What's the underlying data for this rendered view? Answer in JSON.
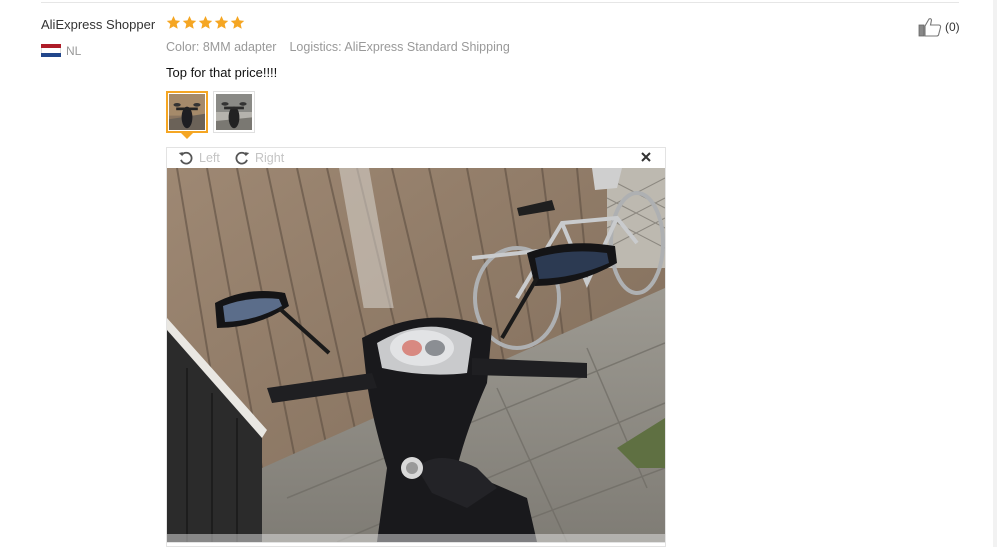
{
  "review": {
    "reviewer_name": "AliExpress Shopper",
    "country_code": "NL",
    "rating": 5,
    "rating_max": 5,
    "color_label": "Color:",
    "color_value": "8MM adapter",
    "logistics_label": "Logistics:",
    "logistics_value": "AliExpress Standard Shipping",
    "text": "Top for that price!!!!",
    "helpful_count": "(0)"
  },
  "viewer": {
    "rotate_left_label": "Left",
    "rotate_right_label": "Right"
  },
  "icons": {
    "star": "star-icon",
    "flag": "netherlands-flag-icon",
    "like": "thumbs-up-icon",
    "rotate_left": "rotate-left-icon",
    "rotate_right": "rotate-right-icon",
    "close": "close-icon"
  },
  "colors": {
    "star": "#f5a623",
    "active_thumb_border": "#f5a623",
    "muted_text": "#999999",
    "rotate_label": "#c4c4c4"
  }
}
